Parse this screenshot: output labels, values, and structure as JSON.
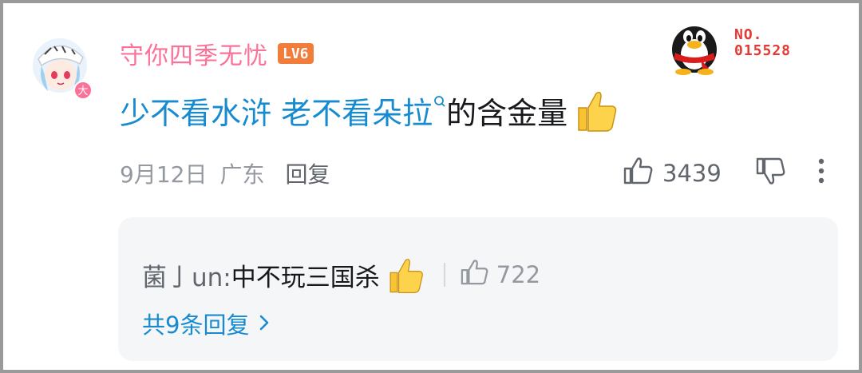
{
  "comment": {
    "username": "守你四季无忧",
    "level_badge": "LV6",
    "nft_label": "NO.",
    "nft_number": "015528",
    "text_link_1": "少不看水浒 老不看朵拉",
    "text_plain": "的含金量",
    "date": "9月12日",
    "location": "广东",
    "reply_label": "回复",
    "like_count": "3439"
  },
  "sub_reply": {
    "user": "菌亅un:",
    "text": " 中不玩三国杀",
    "like_count": "722",
    "view_all": "共9条回复"
  },
  "colors": {
    "username": "#fb7299",
    "link": "#178bcf",
    "level_badge": "#f27c3a",
    "nft": "#e53935"
  },
  "icons": [
    "avatar",
    "qq-penguin-icon",
    "search-icon",
    "thumbs-up-emoji",
    "like-icon",
    "dislike-icon",
    "more-icon",
    "chevron-right-icon"
  ]
}
